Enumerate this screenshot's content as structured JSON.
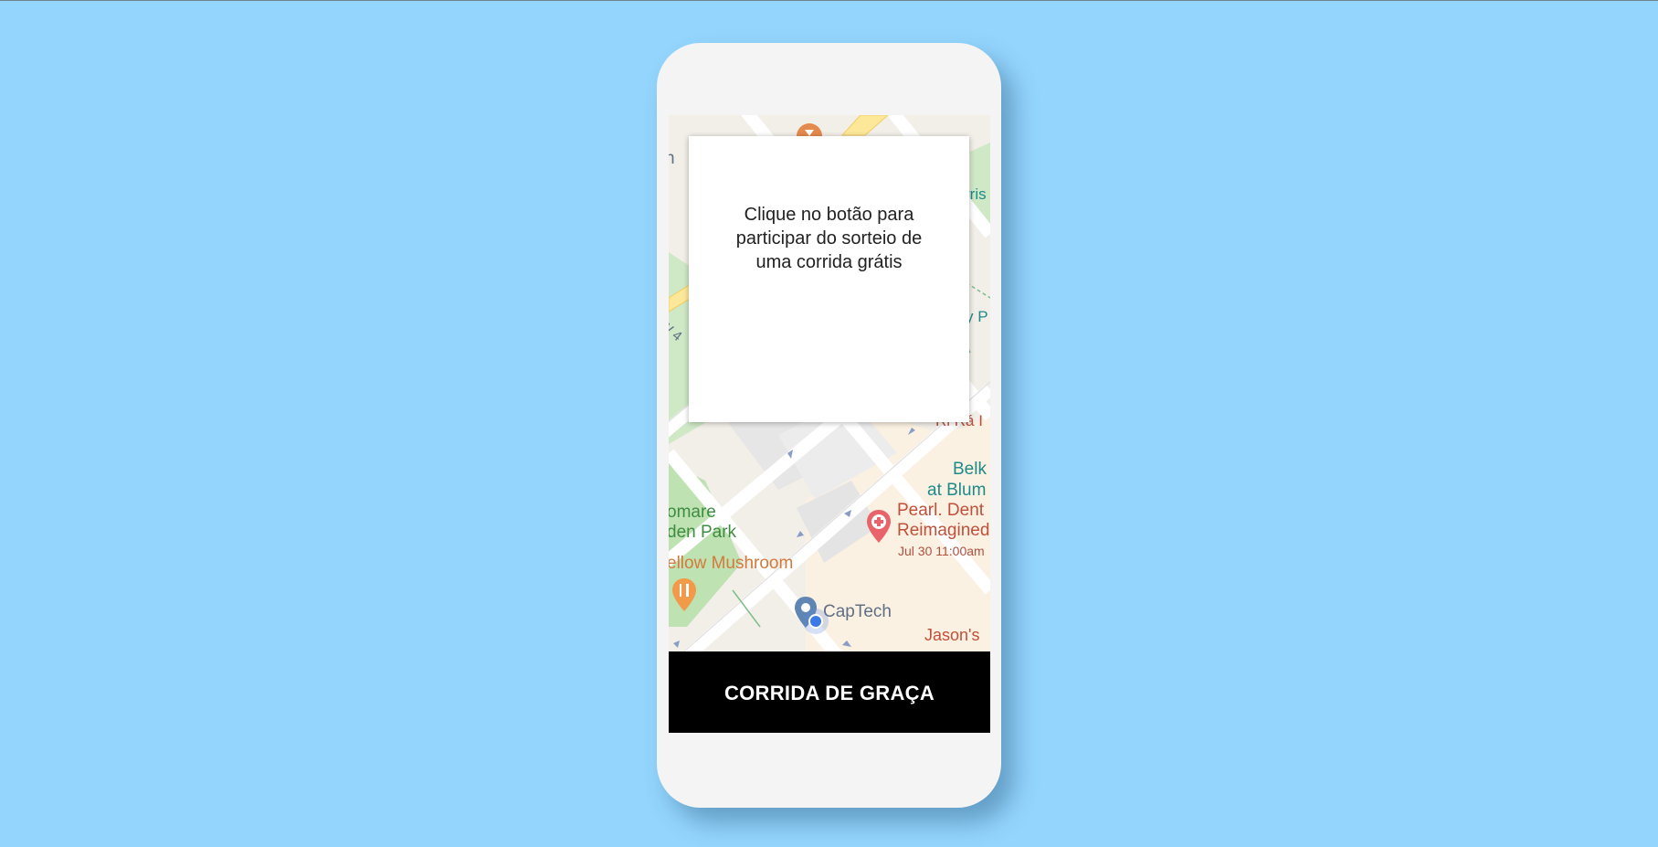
{
  "popup": {
    "message": "Clique no botão para participar do sorteio de uma corrida grátis"
  },
  "cta_button": {
    "label": "CORRIDA DE GRAÇA"
  },
  "map": {
    "labels": {
      "cut_top_left": "n",
      "cut_top_right": "rris",
      "cut_mid_right": "y P",
      "street_w4": "W 4",
      "ri_ra": "Ri Rá I",
      "belk": "Belk",
      "at_blum": "at Blum",
      "park_line1": "omare",
      "park_line2": "den Park",
      "pearl_line1": "Pearl. Dent",
      "pearl_line2": "Reimagined",
      "pearl_date": "Jul 30 11:00am",
      "mushroom": "ellow Mushroom",
      "captech": "CapTech",
      "jasons": "Jason's"
    },
    "icons": [
      "hourglass-icon",
      "hospital-pin-icon",
      "restaurant-pin-icon",
      "location-pin-icon",
      "current-location-dot-icon"
    ]
  },
  "colors": {
    "background": "#94d5fd",
    "phone_body": "#f4f4f4",
    "button_bg": "#000000",
    "button_text": "#ffffff"
  }
}
